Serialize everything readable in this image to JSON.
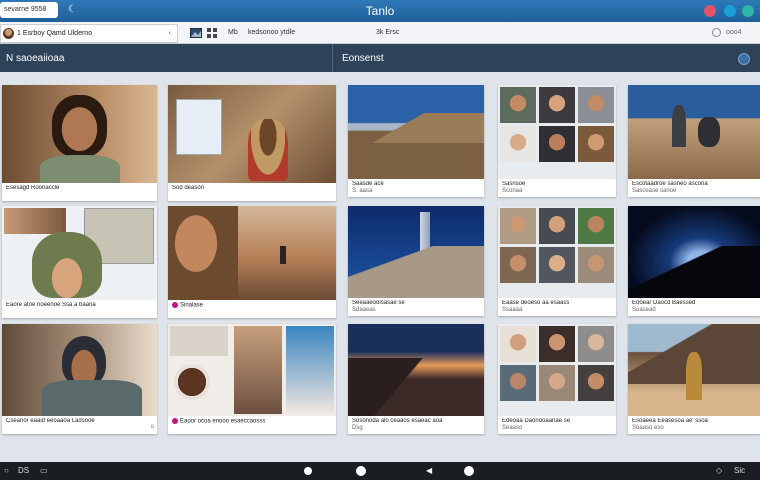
{
  "app": {
    "title": "Tanlo"
  },
  "titlebar": {
    "field_text": "sevarne 9558",
    "buttons": [
      {
        "name": "profile-button",
        "color": "#e0536b"
      },
      {
        "name": "sync-button",
        "color": "#1aa0d9"
      },
      {
        "name": "help-button",
        "color": "#2fb6a6"
      }
    ]
  },
  "toolbar": {
    "tab_label": "1 Esrboy Qamd Ulderno",
    "tab_chevron": "‹",
    "link_1": "Mb",
    "link_2": "kedsonoo ytdle",
    "link_3": "3k Ersc",
    "link_4": "ooo4"
  },
  "sections": {
    "left_title": "N saoeaiioaa",
    "right_title": "Eonsenst"
  },
  "cards": [
    {
      "id": "c1",
      "caption": "Esesagd Roonaccle",
      "caption2": "",
      "corner": ""
    },
    {
      "id": "c2",
      "caption": "Sod deason",
      "caption2": "",
      "corner": ""
    },
    {
      "id": "c3",
      "caption": "Saasde ace",
      "caption2": "S. aasa",
      "corner": ""
    },
    {
      "id": "c4",
      "caption": "Sasnsoe",
      "caption2": "Sconaa",
      "corner": ""
    },
    {
      "id": "c5",
      "caption": "Escotaadroe sasneo ascona",
      "caption2": "Sasosase sanoe",
      "corner": ""
    },
    {
      "id": "c6",
      "caption": "Eaore atoe noeenoe Ssa a baana",
      "caption2": "",
      "corner": ""
    },
    {
      "id": "c7",
      "caption": "Sinalase",
      "caption2": "",
      "corner": ""
    },
    {
      "id": "c8",
      "caption": "Seeaaeoolsasae se",
      "caption2": "Sdaaeas",
      "corner": ""
    },
    {
      "id": "c9",
      "caption": "Eaase deoeso aa esaass",
      "caption2": "Ssaaaa",
      "corner": ""
    },
    {
      "id": "c10",
      "caption": "Eooear Daocd Baessed",
      "caption2": "Soasead",
      "corner": ""
    },
    {
      "id": "c11",
      "caption": "Cseanor eaaid eeoaaoa Ladsooe",
      "caption2": "",
      "corner": "o"
    },
    {
      "id": "c12",
      "caption": "Eaoor ocoa enooo esaeccaosss",
      "caption2": "",
      "corner": ""
    },
    {
      "id": "c13",
      "caption": "Sosonoda alo ceaaos esaeac aoa",
      "caption2": "Dsg",
      "corner": ""
    },
    {
      "id": "c14",
      "caption": "Edeoaa Daonooaanae se",
      "caption2": "Seaaso",
      "corner": ""
    },
    {
      "id": "c15",
      "caption": "Esoaeea Eeasesoa ae' ssoa",
      "caption2": "Soaaso eso",
      "corner": ""
    }
  ],
  "taskbar": {
    "left_1": "○",
    "left_2": "DS",
    "right_1": "◇",
    "right_2": "Sic"
  }
}
